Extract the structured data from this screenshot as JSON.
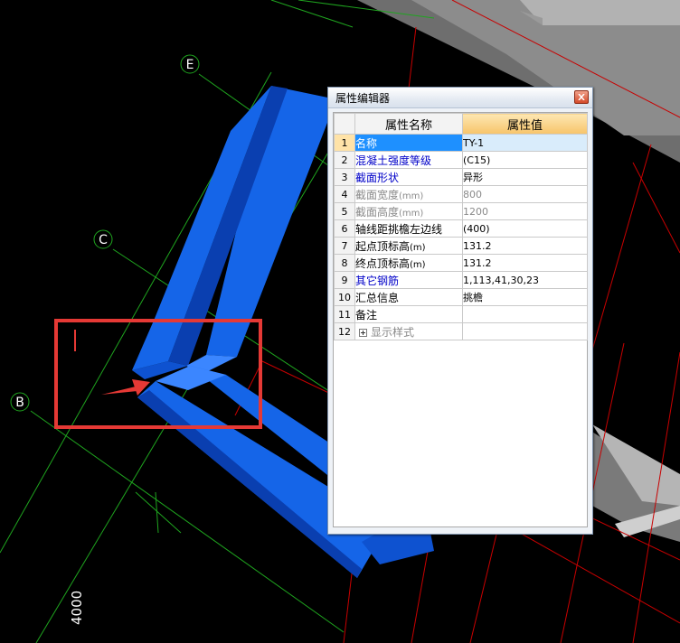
{
  "scene": {
    "axis_labels": [
      "E",
      "C",
      "B"
    ],
    "dimension_text": "4000",
    "colors": {
      "beam_front": "#1565e8",
      "beam_side": "#0a3fb0",
      "beam_top": "#3b86ff",
      "grid_green": "#1fa51f",
      "grid_red": "#c80000",
      "highlight_box": "#e53935",
      "arrow": "#e53935",
      "gray_slab": "#8c8c8c"
    }
  },
  "property_editor": {
    "title": "属性编辑器",
    "close_icon": "close-icon",
    "header": {
      "name_col": "属性名称",
      "value_col": "属性值"
    },
    "rows": [
      {
        "index": "1",
        "name": "名称",
        "unit": "",
        "value": "TY-1",
        "style": "blue"
      },
      {
        "index": "2",
        "name": "混凝土强度等级",
        "unit": "",
        "value": "(C15)",
        "style": "blue"
      },
      {
        "index": "3",
        "name": "截面形状",
        "unit": "",
        "value": "异形",
        "style": "blue"
      },
      {
        "index": "4",
        "name": "截面宽度",
        "unit": "(mm)",
        "value": "800",
        "style": "gray"
      },
      {
        "index": "5",
        "name": "截面高度",
        "unit": "(mm)",
        "value": "1200",
        "style": "gray"
      },
      {
        "index": "6",
        "name": "轴线距挑檐左边线",
        "unit": "",
        "value": "(400)",
        "style": "black"
      },
      {
        "index": "7",
        "name": "起点顶标高",
        "unit": "(m)",
        "value": "131.2",
        "style": "black"
      },
      {
        "index": "8",
        "name": "终点顶标高",
        "unit": "(m)",
        "value": "131.2",
        "style": "black"
      },
      {
        "index": "9",
        "name": "其它钢筋",
        "unit": "",
        "value": "1,113,41,30,23",
        "style": "blue"
      },
      {
        "index": "10",
        "name": "汇总信息",
        "unit": "",
        "value": "挑檐",
        "style": "black"
      },
      {
        "index": "11",
        "name": "备注",
        "unit": "",
        "value": "",
        "style": "black"
      },
      {
        "index": "12",
        "name": "显示样式",
        "unit": "",
        "value": "",
        "style": "gray",
        "expandable": true
      }
    ]
  }
}
